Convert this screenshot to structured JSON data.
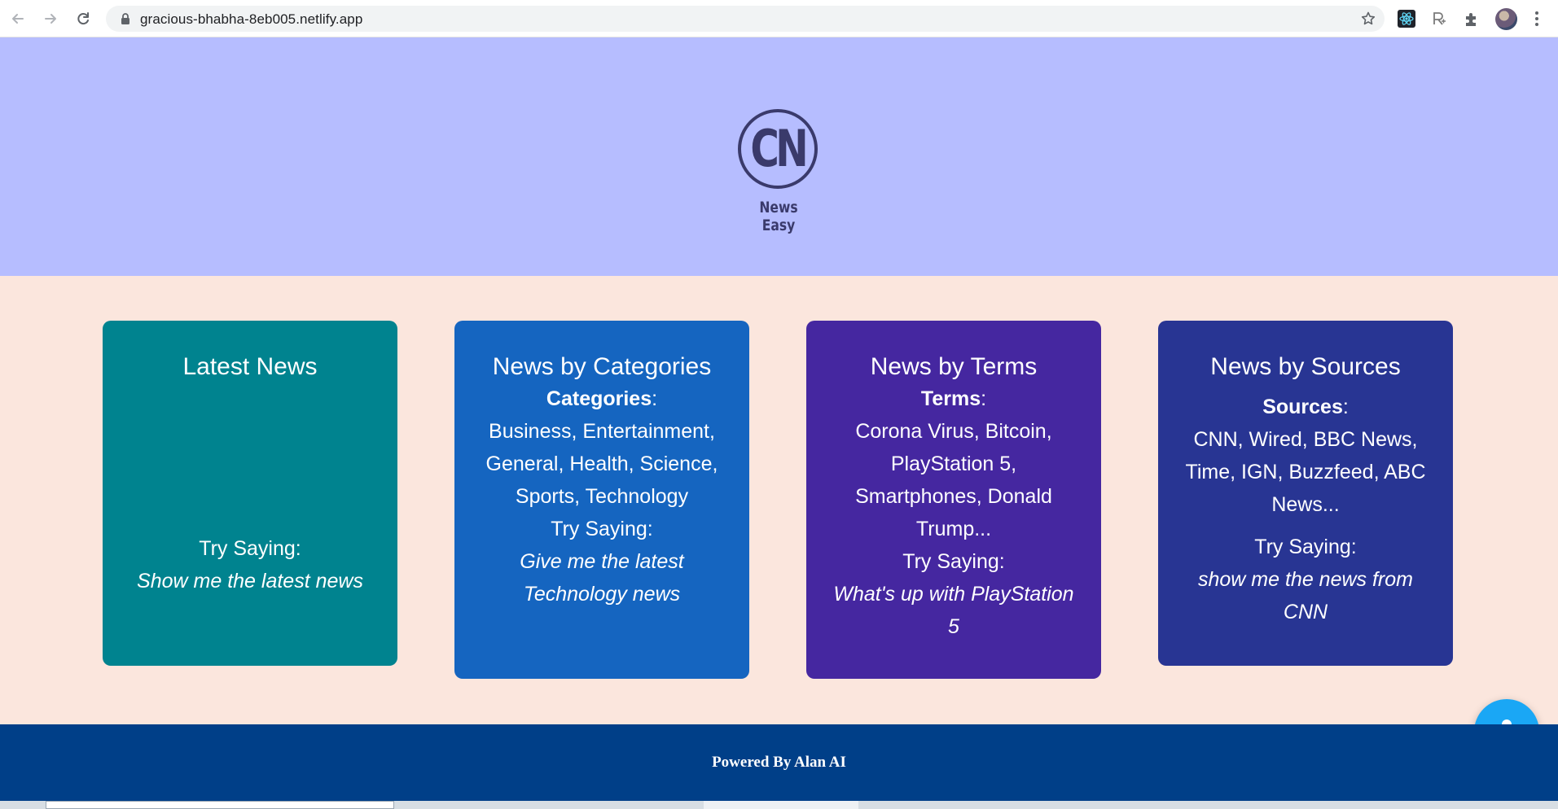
{
  "browser": {
    "url": "gracious-bhabha-8eb005.netlify.app"
  },
  "header": {
    "logo_letters": "CN",
    "logo_subtitle": "News Easy"
  },
  "cards": [
    {
      "title": "Latest News",
      "try_label": "Try Saying:",
      "example": "Show me the latest news",
      "color": "#00838f"
    },
    {
      "title": "News by Categories",
      "list_label": "Categories",
      "list_text": "Business, Entertainment, General, Health, Science, Sports, Technology",
      "try_label": "Try Saying:",
      "example": "Give me the latest Technology news",
      "color": "#1565c0"
    },
    {
      "title": "News by Terms",
      "list_label": "Terms",
      "list_text": "Corona Virus, Bitcoin, PlayStation 5, Smartphones, Donald Trump...",
      "try_label": "Try Saying:",
      "example": "What's up with PlayStation 5",
      "color": "#4527a0"
    },
    {
      "title": "News by Sources",
      "list_label": "Sources",
      "list_text": "CNN, Wired, BBC News, Time, IGN, Buzzfeed, ABC News...",
      "try_label": "Try Saying:",
      "example": "show me the news from CNN",
      "color": "#283593"
    }
  ],
  "footer": {
    "text": "Powered By Alan AI"
  },
  "colors": {
    "hero_bg": "#b6bdff",
    "cards_bg": "#fbe6dd",
    "footer_bg": "#003f88",
    "mic_bg": "#1aa7f5"
  }
}
